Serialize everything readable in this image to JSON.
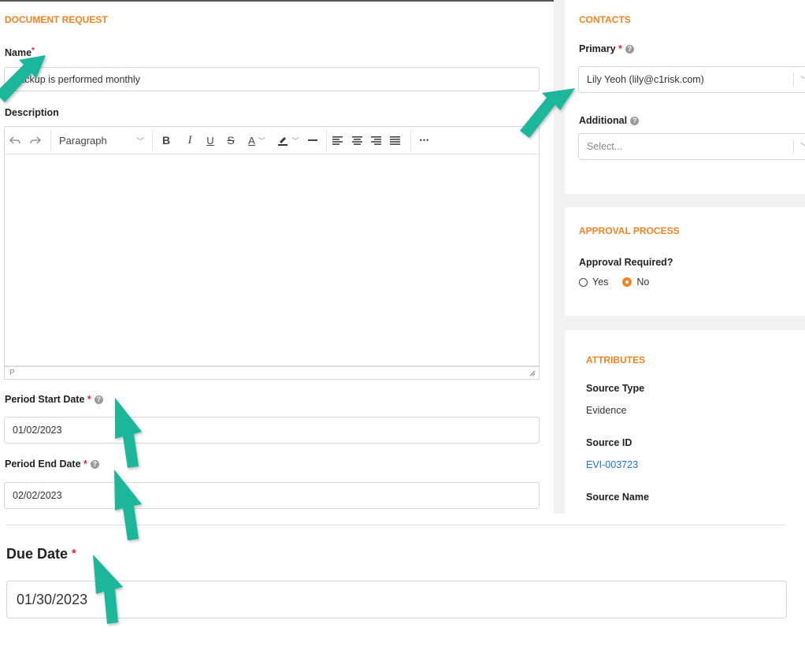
{
  "document_request": {
    "section_title": "DOCUMENT REQUEST",
    "name_label": "Name",
    "name_value": "Backup is performed monthly",
    "description_label": "Description",
    "editor": {
      "paragraph_label": "Paragraph",
      "bold": "B",
      "italic": "I",
      "underline": "U",
      "strike": "S",
      "text_color": "A",
      "more": "•••",
      "status_path": "P"
    },
    "period_start_label": "Period Start Date",
    "period_start_value": "01/02/2023",
    "period_end_label": "Period End Date",
    "period_end_value": "02/02/2023",
    "due_date_label": "Due Date",
    "due_date_value": "01/30/2023"
  },
  "contacts": {
    "section_title": "CONTACTS",
    "primary_label": "Primary",
    "primary_value": "Lily Yeoh (lily@c1risk.com)",
    "additional_label": "Additional",
    "additional_placeholder": "Select..."
  },
  "approval": {
    "section_title": "APPROVAL PROCESS",
    "question_label": "Approval Required?",
    "options": [
      "Yes",
      "No"
    ],
    "selected": "No"
  },
  "attributes": {
    "section_title": "ATTRIBUTES",
    "source_type_label": "Source Type",
    "source_type_value": "Evidence",
    "source_id_label": "Source ID",
    "source_id_value": "EVI-003723",
    "source_name_label": "Source Name"
  },
  "colors": {
    "accent": "#f58220",
    "required": "#d9243a",
    "link": "#1a73e8",
    "annotation_arrow": "#1fb69a"
  }
}
